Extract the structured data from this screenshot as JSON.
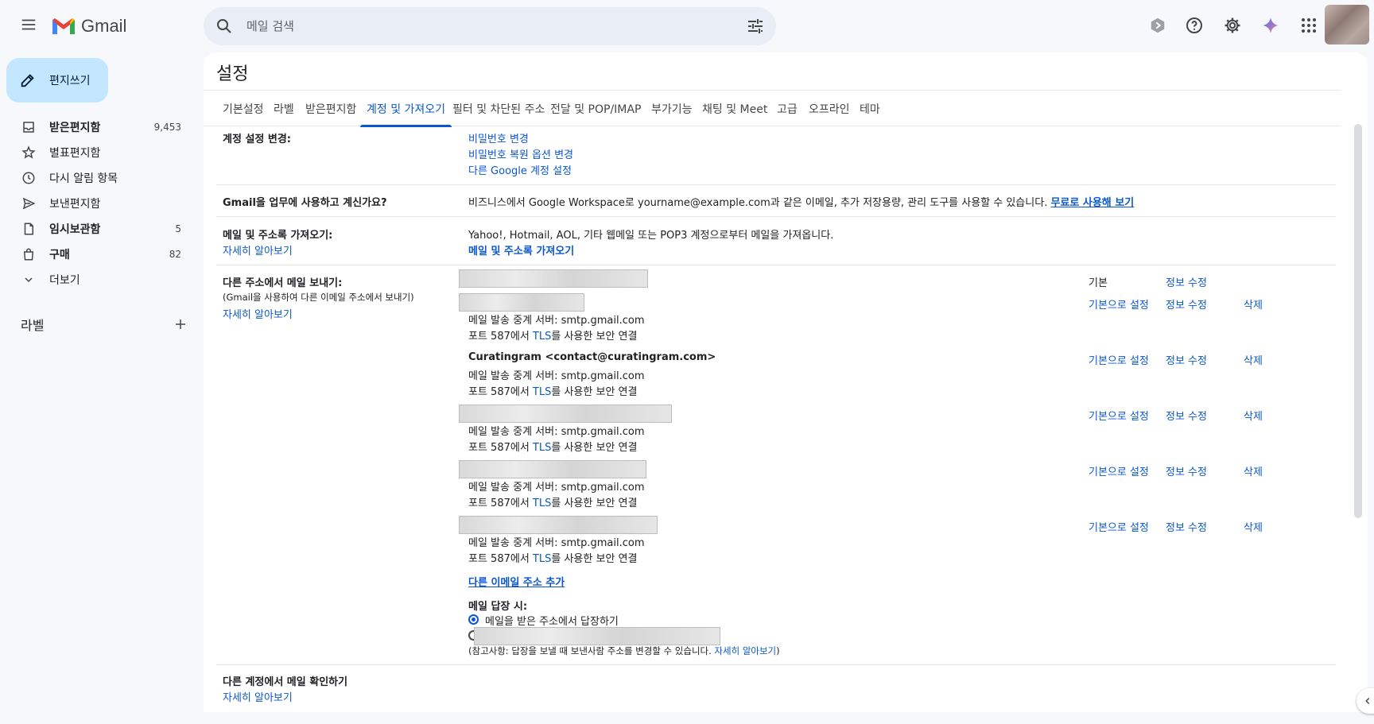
{
  "header": {
    "app_name": "Gmail",
    "search_placeholder": "메일 검색",
    "icons": [
      "menu-icon",
      "search-icon",
      "tune-icon",
      "support-icon",
      "help-icon",
      "settings-icon",
      "gemini-icon",
      "apps-icon"
    ]
  },
  "compose": {
    "label": "편지쓰기"
  },
  "nav": {
    "items": [
      {
        "label": "받은편지함",
        "count": "9,453",
        "bold": true
      },
      {
        "label": "별표편지함",
        "count": ""
      },
      {
        "label": "다시 알림 항목",
        "count": ""
      },
      {
        "label": "보낸편지함",
        "count": ""
      },
      {
        "label": "임시보관함",
        "count": "5",
        "bold": true
      },
      {
        "label": "구매",
        "count": "82",
        "bold": true
      },
      {
        "label": "더보기",
        "count": ""
      }
    ],
    "labels_title": "라벨"
  },
  "settings": {
    "title": "설정",
    "tabs": [
      "기본설정",
      "라벨",
      "받은편지함",
      "계정 및 가져오기",
      "필터 및 차단된 주소",
      "전달 및 POP/IMAP",
      "부가기능",
      "채팅 및 Meet",
      "고급",
      "오프라인",
      "테마"
    ],
    "active_tab": "계정 및 가져오기"
  },
  "account": {
    "label": "계정 설정 변경:",
    "links": [
      "비밀번호 변경",
      "비밀번호 복원 옵션 변경",
      "다른 Google 계정 설정"
    ]
  },
  "workspace": {
    "label": "Gmail을 업무에 사용하고 계신가요?",
    "text": "비즈니스에서 Google Workspace로 yourname@example.com과 같은 이메일, 추가 저장용량, 관리 도구를 사용할 수 있습니다.",
    "link": "무료로 사용해 보기"
  },
  "import": {
    "label": "메일 및 주소록 가져오기:",
    "learn_more": "자세히 알아보기",
    "text": "Yahoo!, Hotmail, AOL, 기타 웹메일 또는 POP3 계정으로부터 메일을 가져옵니다.",
    "link": "메일 및 주소록 가져오기"
  },
  "send_as": {
    "label": "다른 주소에서 메일 보내기:",
    "note": "(Gmail을 사용하여 다른 이메일 주소에서 보내기)",
    "learn_more": "자세히 알아보기",
    "default_text": "기본",
    "set_default": "기본으로 설정",
    "edit_info": "정보 수정",
    "delete": "삭제",
    "smtp_line": "메일 발송 중계 서버: smtp.gmail.com",
    "tls_prefix": "포트 587에서 ",
    "tls_word": "TLS",
    "tls_suffix": "를 사용한 보안 연결",
    "named_address": "Curatingram <contact@curatingram.com>",
    "add_link": "다른 이메일 주소 추가"
  },
  "reply": {
    "label": "메일 답장 시:",
    "option1": "메일을 받은 주소에서 답장하기",
    "note_prefix": "(참고사항: 답장을 보낼 때 보낸사람 주소를 변경할 수 있습니다. ",
    "note_link": "자세히 알아보기",
    "note_suffix": ")"
  },
  "check_mail": {
    "label": "다른 계정에서 메일 확인하기",
    "learn_more": "자세히 알아보기"
  },
  "colors": {
    "accent": "#0b57d0",
    "compose_bg": "#c2e7ff",
    "page_bg": "#f6f8fc"
  }
}
